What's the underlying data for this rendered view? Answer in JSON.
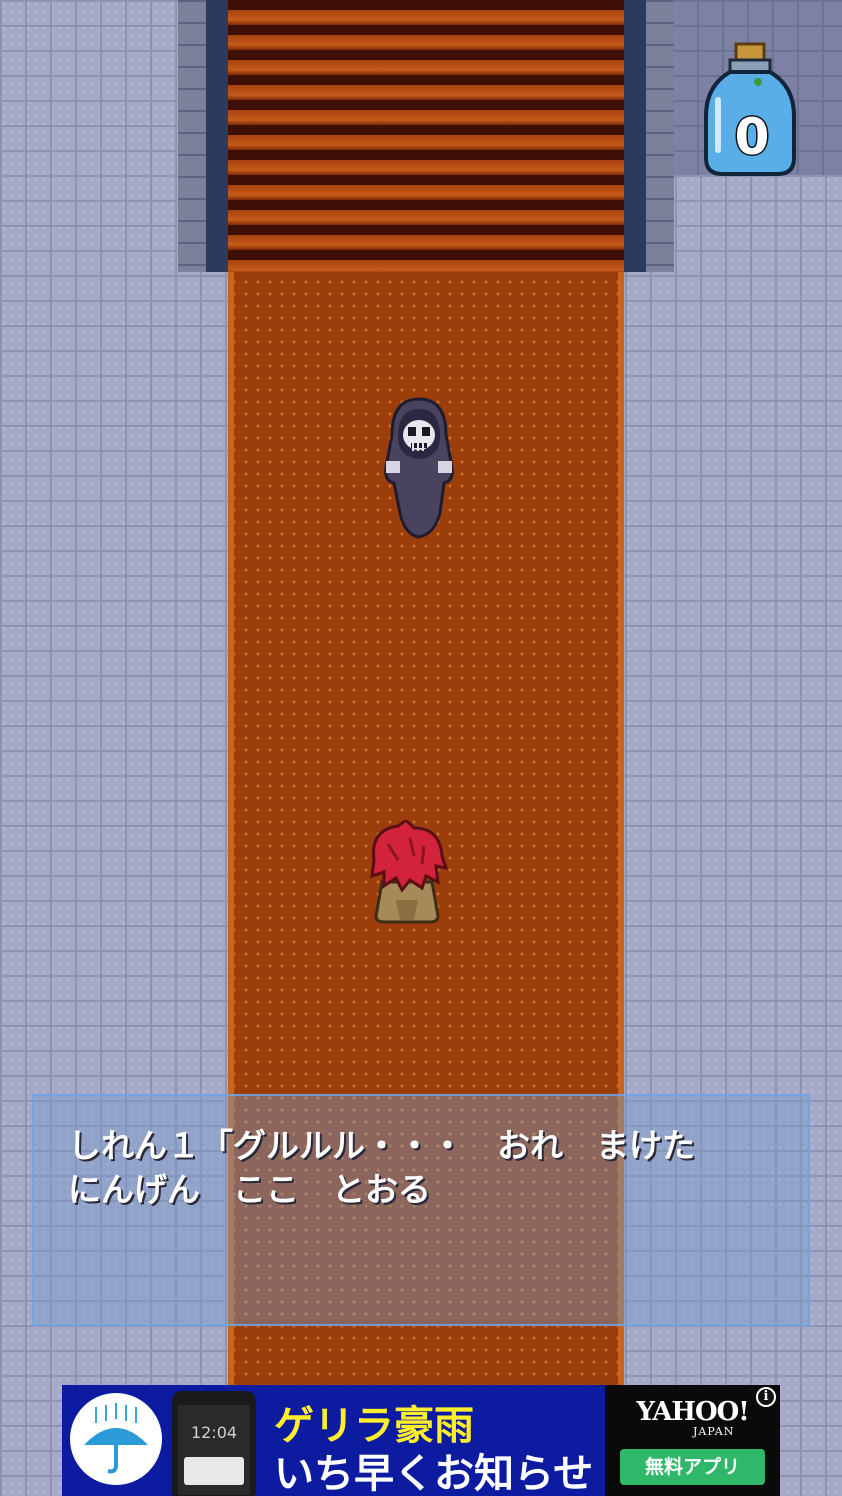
{
  "hud": {
    "item_icon": "potion-bottle-icon",
    "item_count": "0"
  },
  "scene": {
    "enemy": "reaper-ghost-sprite",
    "player": "red-haired-hero-sprite"
  },
  "dialog": {
    "line1": "しれん１「グルルル・・・　おれ　まけた",
    "line2": "にんげん　ここ　とおる"
  },
  "ad": {
    "icon": "umbrella-rain-icon",
    "phone_time": "12:04",
    "headline_1": "ゲリラ豪雨",
    "headline_2": "いち早くお知らせ",
    "brand": "YAHOO!",
    "brand_sub": "JAPAN",
    "cta": "無料アプリ",
    "info_icon": "info-icon",
    "info_label": "i"
  },
  "colors": {
    "floor": "#a6a9c7",
    "carpet": "#9c3e0c",
    "dialog_border": "#6ea5e6",
    "ad_bg": "#0d1ba0",
    "ad_cta": "#2fb86a"
  }
}
